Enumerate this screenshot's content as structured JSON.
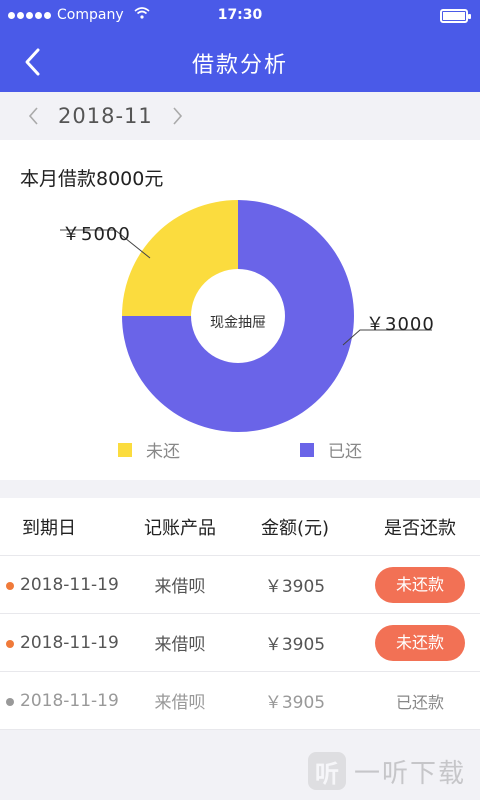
{
  "status_bar": {
    "carrier": "Company",
    "time": "17:30"
  },
  "nav": {
    "title": "借款分析"
  },
  "month_selector": {
    "month": "2018-11"
  },
  "summary": {
    "text": "本月借款8000元"
  },
  "chart_data": {
    "type": "pie",
    "center_label": "现金抽屉",
    "series": [
      {
        "name": "未还",
        "value": 2000,
        "label": "￥5000",
        "color": "#fbdc3e"
      },
      {
        "name": "已还",
        "value": 6000,
        "label": "￥3000",
        "color": "#6a64e8"
      }
    ],
    "legend_placement": "bottom"
  },
  "legend": [
    {
      "label": "未还",
      "color": "#fbdc3e"
    },
    {
      "label": "已还",
      "color": "#6a64e8"
    }
  ],
  "table": {
    "headers": [
      "到期日",
      "记账产品",
      "金额(元)",
      "是否还款"
    ],
    "rows": [
      {
        "date": "2018-11-19",
        "product": "来借呗",
        "amount": "￥3905",
        "status": "未还款",
        "paid": false,
        "bullet_color": "#f07a3a"
      },
      {
        "date": "2018-11-19",
        "product": "来借呗",
        "amount": "￥3905",
        "status": "未还款",
        "paid": false,
        "bullet_color": "#f07a3a"
      },
      {
        "date": "2018-11-19",
        "product": "来借呗",
        "amount": "￥3905",
        "status": "已还款",
        "paid": true,
        "bullet_color": "#999999"
      }
    ]
  },
  "watermark": {
    "logo": "听",
    "text": "一听下载"
  },
  "colors": {
    "brand": "#4a5ae8",
    "unpaid_button": "#f27155",
    "unpaid_slice": "#fbdc3e",
    "paid_slice": "#6a64e8"
  }
}
